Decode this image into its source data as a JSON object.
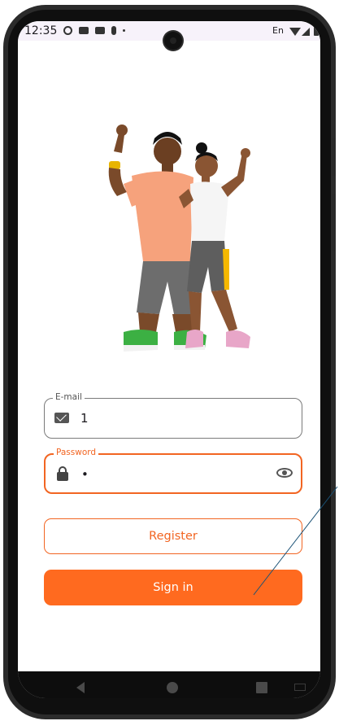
{
  "status_bar": {
    "time": "12:35",
    "language": "En",
    "icons": [
      "settings-icon",
      "youtube-icon",
      "youtube-icon",
      "person-icon",
      "dot-icon",
      "wifi-icon",
      "signal-icon",
      "battery-icon"
    ]
  },
  "login": {
    "email": {
      "label": "E-mail",
      "value": "1",
      "icon": "mail-icon"
    },
    "password": {
      "label": "Password",
      "value": "•",
      "icon": "lock-icon",
      "toggle_icon": "eye-icon"
    },
    "register_label": "Register",
    "signin_label": "Sign in"
  },
  "nav_bar": {
    "icons": [
      "back-icon",
      "home-icon",
      "recents-icon",
      "keyboard-icon"
    ]
  },
  "colors": {
    "accent": "#ff6a1f",
    "accent_border": "#f26522",
    "status_bar_bg": "#f7f2fa",
    "nav_bar_bg": "#0d0d0d"
  }
}
